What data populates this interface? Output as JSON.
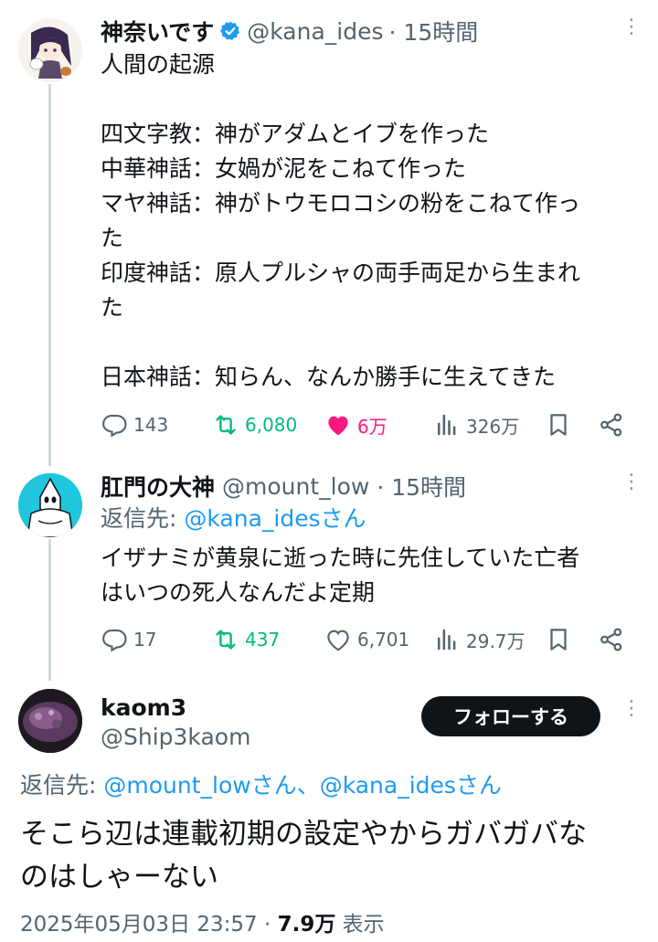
{
  "tweet1": {
    "name": "神奈いです",
    "handle": "@kana_ides",
    "time": "· 15時間",
    "text": "人間の起源\n\n四文字教：神がアダムとイブを作った\n中華神話：女媧が泥をこねて作った\nマヤ神話：神がトウモロコシの粉をこねて作っ\nた\n印度神話：原人プルシャの両手両足から生まれ\nた\n\n日本神話：知らん、なんか勝手に生えてきた",
    "replies": "143",
    "retweets": "6,080",
    "likes": "6万",
    "views": "326万"
  },
  "tweet2": {
    "name": "肛門の大神",
    "handle": "@mount_low",
    "time": "· 15時間",
    "reply_prefix": "返信先: ",
    "reply_to": "@kana_idesさん",
    "text": "イザナミが黄泉に逝った時に先住していた亡者\nはいつの死人なんだよ定期",
    "replies": "17",
    "retweets": "437",
    "likes": "6,701",
    "views": "29.7万"
  },
  "tweet3": {
    "name": "kaom3",
    "handle": "@Ship3kaom",
    "follow_label": "フォローする",
    "reply_prefix": "返信先: ",
    "reply_to": "@mount_lowさん、@kana_idesさん",
    "text": "そこら辺は連載初期の設定やからガバガバな\nのはしゃーない",
    "timestamp": "2025年05月03日 23:57 · ",
    "view_count": "7.9万",
    "view_label": " 表示"
  },
  "colors": {
    "accent": "#1d9bf0",
    "retweet": "#00ba7c",
    "like": "#f91880",
    "muted": "#536471"
  }
}
